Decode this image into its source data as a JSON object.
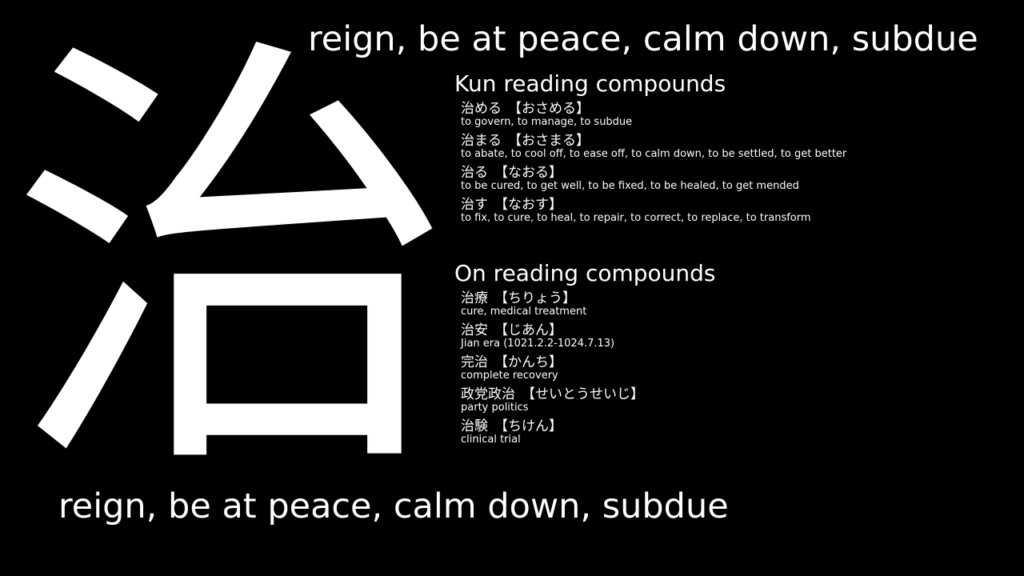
{
  "kanji": {
    "character": "治"
  },
  "meaning": {
    "top": "reign, be at peace, calm down, subdue",
    "bottom": "reign, be at peace, calm down, subdue"
  },
  "kun": {
    "title": "Kun reading compounds",
    "items": [
      {
        "word": "治める",
        "reading": "【おさめる】",
        "gloss": "to govern, to manage, to subdue"
      },
      {
        "word": "治まる",
        "reading": "【おさまる】",
        "gloss": "to abate, to cool off, to ease off, to calm down, to be settled, to get better"
      },
      {
        "word": "治る",
        "reading": "【なおる】",
        "gloss": "to be cured, to get well, to be fixed, to be healed, to get mended"
      },
      {
        "word": "治す",
        "reading": "【なおす】",
        "gloss": "to fix, to cure, to heal, to repair, to correct, to replace, to transform"
      }
    ]
  },
  "on": {
    "title": "On reading compounds",
    "items": [
      {
        "word": "治療",
        "reading": "【ちりょう】",
        "gloss": "cure, medical treatment"
      },
      {
        "word": "治安",
        "reading": "【じあん】",
        "gloss": "Jian era (1021.2.2-1024.7.13)"
      },
      {
        "word": "完治",
        "reading": "【かんち】",
        "gloss": "complete recovery"
      },
      {
        "word": "政党政治",
        "reading": "【せいとうせいじ】",
        "gloss": "party politics"
      },
      {
        "word": "治験",
        "reading": "【ちけん】",
        "gloss": "clinical trial"
      }
    ]
  }
}
